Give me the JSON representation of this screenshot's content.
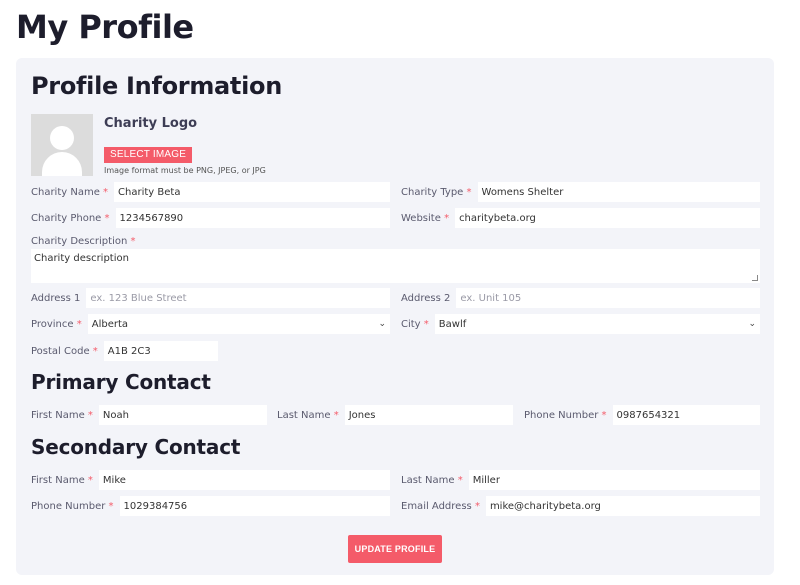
{
  "page_title": "My Profile",
  "profile": {
    "title": "Profile Information",
    "logo_label": "Charity Logo",
    "select_image": "SELECT IMAGE",
    "image_hint": "Image format must be PNG, JPEG, or JPG",
    "charity_name": {
      "label": "Charity Name",
      "value": "Charity Beta"
    },
    "charity_type": {
      "label": "Charity Type",
      "value": "Womens Shelter"
    },
    "charity_phone": {
      "label": "Charity Phone",
      "value": "1234567890"
    },
    "website": {
      "label": "Website",
      "value": "charitybeta.org"
    },
    "description": {
      "label": "Charity Description",
      "value": "Charity description"
    },
    "address1": {
      "label": "Address 1",
      "placeholder": "ex. 123 Blue Street"
    },
    "address2": {
      "label": "Address 2",
      "placeholder": "ex. Unit 105"
    },
    "province": {
      "label": "Province",
      "value": "Alberta"
    },
    "city": {
      "label": "City",
      "value": "Bawlf"
    },
    "postal_code": {
      "label": "Postal Code",
      "value": "A1B 2C3"
    }
  },
  "primary": {
    "title": "Primary Contact",
    "first_name": {
      "label": "First Name",
      "value": "Noah"
    },
    "last_name": {
      "label": "Last Name",
      "value": "Jones"
    },
    "phone": {
      "label": "Phone Number",
      "value": "0987654321"
    }
  },
  "secondary": {
    "title": "Secondary Contact",
    "first_name": {
      "label": "First Name",
      "value": "Mike"
    },
    "last_name": {
      "label": "Last Name",
      "value": "Miller"
    },
    "phone": {
      "label": "Phone Number",
      "value": "1029384756"
    },
    "email": {
      "label": "Email Address",
      "value": "mike@charitybeta.org"
    }
  },
  "required_mark": "*",
  "update_button": "UPDATE PROFILE",
  "colors": {
    "accent": "#f45b69",
    "card_bg": "#f3f4f9",
    "title": "#1d1d2c"
  }
}
